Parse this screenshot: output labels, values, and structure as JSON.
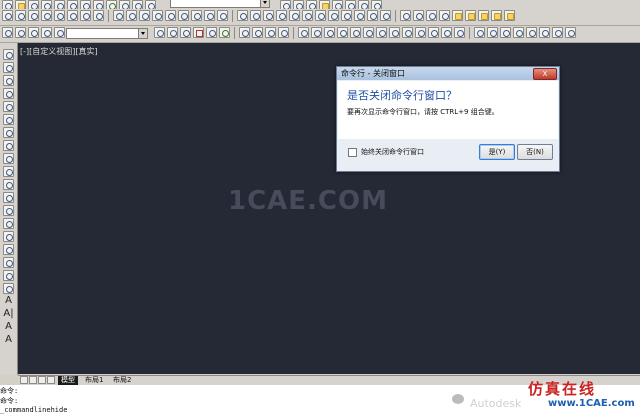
{
  "viewport_label": "[-][自定义视图][真实]",
  "watermark": "1CAE.COM",
  "dialog": {
    "title": "命令行 - 关闭窗口",
    "question": "是否关闭命令行窗口？",
    "detail": "要再次显示命令行窗口，请按 CTRL+9 组合键。",
    "checkbox_label": "始终关闭命令行窗口",
    "yes_label": "是(Y)",
    "no_label": "否(N)",
    "close_label": "X"
  },
  "tabs": {
    "model": "模型",
    "layout1": "布局1",
    "layout2": "布局2"
  },
  "command": {
    "line1": "命令:",
    "line2": "命令:",
    "line3": "_commandlinehide"
  },
  "brand": {
    "cn": "仿真在线",
    "url": "www.1CAE.com",
    "autodesk": "Autodesk"
  },
  "left_toolbar_glyphs": [
    "A",
    "A|",
    "A",
    "A"
  ]
}
